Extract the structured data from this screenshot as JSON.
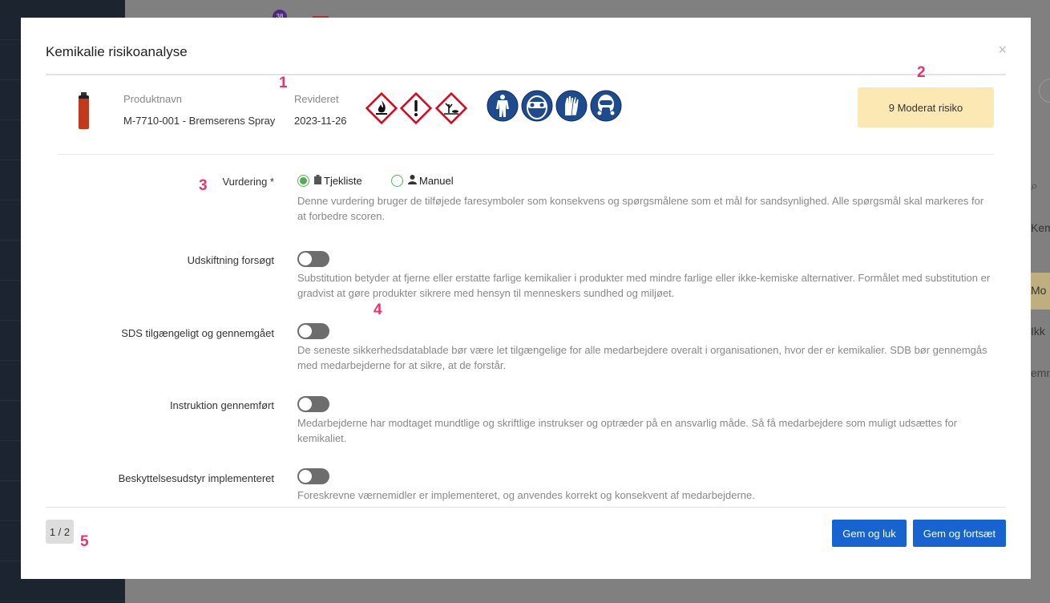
{
  "background": {
    "badge_count": "38",
    "right_texts": [
      "Kem",
      "Mo",
      "Ikk",
      "emne"
    ]
  },
  "modal": {
    "title": "Kemikalie risikoanalyse",
    "close_label": "×"
  },
  "markers": [
    "1",
    "2",
    "3",
    "4",
    "5"
  ],
  "product": {
    "name_label": "Produktnavn",
    "name_value": "M-7710-001 - Bremserens Spray",
    "revised_label": "Revideret",
    "revised_value": "2023-11-26",
    "hazard_icons": [
      "flammable-icon",
      "exclamation-icon",
      "environment-hazard-icon"
    ],
    "ppe_icons": [
      "protective-suit-icon",
      "goggles-icon",
      "gloves-icon",
      "respirator-icon"
    ],
    "hazard_color": "#e3001b",
    "ppe_color": "#1e4a8e"
  },
  "risk": {
    "label": "9 Moderat risiko",
    "color": "#fce8b2"
  },
  "assessment": {
    "label": "Vurdering *",
    "options": [
      "Tjekliste",
      "Manuel"
    ],
    "selected": "Tjekliste",
    "description": "Denne vurdering bruger de tilføjede faresymboler som konsekvens og spørgsmålene som et mål for sandsynlighed. Alle spørgsmål skal markeres for at forbedre scoren."
  },
  "questions": [
    {
      "label": "Udskiftning forsøgt",
      "checked": false,
      "description": "Substitution betyder at fjerne eller erstatte farlige kemikalier i produkter med mindre farlige eller ikke-kemiske alternativer. Formålet med substitution er gradvist at gøre produkter sikrere med hensyn til menneskers sundhed og miljøet."
    },
    {
      "label": "SDS tilgængeligt og gennemgået",
      "checked": false,
      "description": "De seneste sikkerhedsdatablade bør være let tilgængelige for alle medarbejdere overalt i organisationen, hvor der er kemikalier. SDB bør gennemgås med medarbejderne for at sikre, at de forstår."
    },
    {
      "label": "Instruktion gennemført",
      "checked": false,
      "description": "Medarbejderne har modtaget mundtlige og skriftlige instrukser og optræder på en ansvarlig måde. Så få medarbejdere som muligt udsættes for kemikaliet."
    },
    {
      "label": "Beskyttelsesudstyr implementeret",
      "checked": false,
      "description": "Foreskrevne værnemidler er implementeret, og anvendes korrekt og konsekvent af medarbejderne."
    }
  ],
  "footer": {
    "page_indicator": "1 / 2",
    "save_close": "Gem og luk",
    "save_continue": "Gem og fortsæt",
    "button_color": "#1764d0"
  }
}
